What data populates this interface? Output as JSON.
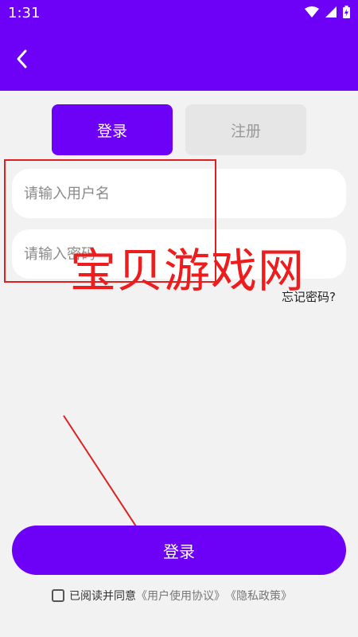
{
  "status_bar": {
    "time": "1:31"
  },
  "header": {
    "back_icon": "chevron-left-icon"
  },
  "tabs": [
    {
      "label": "登录",
      "active": true
    },
    {
      "label": "注册",
      "active": false
    }
  ],
  "form": {
    "username_placeholder": "请输入用户名",
    "password_placeholder": "请输入密码",
    "forgot_password": "忘记密码?"
  },
  "login_button": "登录",
  "agreement": {
    "prefix": "已阅读并同意",
    "user_agreement": "《用户使用协议》",
    "privacy_policy": "《隐私政策》"
  },
  "watermark": "宝贝游戏网",
  "colors": {
    "primary": "#6d00f6",
    "annotation": "#e02020"
  }
}
